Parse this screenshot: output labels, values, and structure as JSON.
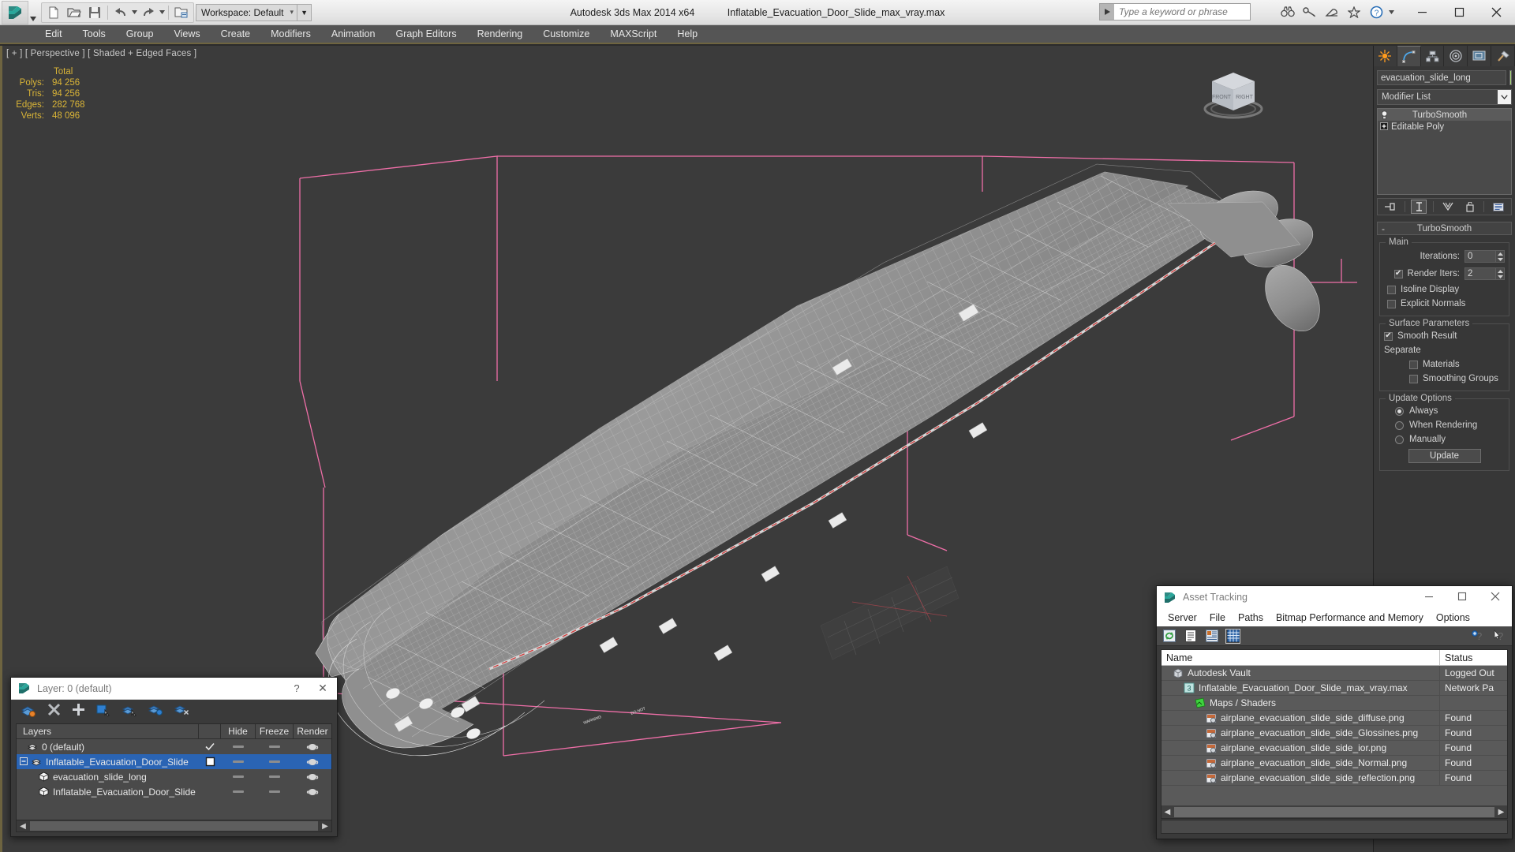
{
  "titlebar": {
    "workspace_label": "Workspace: Default",
    "app_title": "Autodesk 3ds Max  2014 x64",
    "file_title": "Inflatable_Evacuation_Door_Slide_max_vray.max",
    "search_placeholder": "Type a keyword or phrase",
    "quick_access": [
      {
        "name": "new-file-icon",
        "label": "New"
      },
      {
        "name": "open-file-icon",
        "label": "Open"
      },
      {
        "name": "save-file-icon",
        "label": "Save"
      },
      {
        "name": "undo-icon",
        "label": "Undo"
      },
      {
        "name": "redo-icon",
        "label": "Redo"
      },
      {
        "name": "set-project-folder-icon",
        "label": "Set Project Folder"
      }
    ],
    "help_icons": [
      {
        "name": "search-binoculars-icon",
        "label": "Search"
      },
      {
        "name": "key-icon",
        "label": "Subscription"
      },
      {
        "name": "satellite-dish-icon",
        "label": "Communication Center"
      },
      {
        "name": "favorites-star-icon",
        "label": "Favorites"
      },
      {
        "name": "help-question-icon",
        "label": "Help"
      }
    ],
    "window_controls": [
      {
        "name": "minimize-button",
        "glyph": "—"
      },
      {
        "name": "restore-button",
        "glyph": "☐"
      },
      {
        "name": "close-button",
        "glyph": "✕"
      }
    ]
  },
  "menubar": {
    "items": [
      {
        "label": "Edit"
      },
      {
        "label": "Tools"
      },
      {
        "label": "Group"
      },
      {
        "label": "Views"
      },
      {
        "label": "Create"
      },
      {
        "label": "Modifiers"
      },
      {
        "label": "Animation"
      },
      {
        "label": "Graph Editors"
      },
      {
        "label": "Rendering"
      },
      {
        "label": "Customize"
      },
      {
        "label": "MAXScript"
      },
      {
        "label": "Help"
      }
    ]
  },
  "viewport": {
    "label": "[ + ] [ Perspective ] [ Shaded + Edged Faces ]",
    "stats": {
      "column_header": "Total",
      "rows": [
        {
          "label": "Polys:",
          "value": "94 256"
        },
        {
          "label": "Tris:",
          "value": "94 256"
        },
        {
          "label": "Edges:",
          "value": "282 768"
        },
        {
          "label": "Verts:",
          "value": "48 096"
        }
      ]
    },
    "viewcube": {
      "front_face": "FRONT",
      "side_face": "RIGHT"
    }
  },
  "command_panel": {
    "tabs": [
      {
        "name": "tab-create",
        "label": "Create",
        "active": false
      },
      {
        "name": "tab-modify",
        "label": "Modify",
        "active": true
      },
      {
        "name": "tab-hierarchy",
        "label": "Hierarchy",
        "active": false
      },
      {
        "name": "tab-motion",
        "label": "Motion",
        "active": false
      },
      {
        "name": "tab-display",
        "label": "Display",
        "active": false
      },
      {
        "name": "tab-utilities",
        "label": "Utilities",
        "active": false
      }
    ],
    "object_name": "evacuation_slide_long",
    "object_color": "#a8d87a",
    "modifier_list_label": "Modifier List",
    "modifier_stack": [
      {
        "label": "TurboSmooth",
        "selected": true
      },
      {
        "label": "Editable Poly",
        "selected": false
      }
    ],
    "stack_buttons": [
      {
        "name": "pin-stack-button"
      },
      {
        "name": "show-end-result-button"
      },
      {
        "name": "make-unique-button"
      },
      {
        "name": "remove-modifier-button"
      },
      {
        "name": "configure-modifier-sets-button"
      }
    ],
    "rollout": {
      "title": "TurboSmooth",
      "collapse_glyph": "-",
      "main_group_title": "Main",
      "iterations_label": "Iterations:",
      "iterations_value": "0",
      "render_iters_label": "Render Iters:",
      "render_iters_value": "2",
      "render_iters_checked": true,
      "isoline_display_label": "Isoline Display",
      "isoline_display_checked": false,
      "explicit_normals_label": "Explicit Normals",
      "explicit_normals_checked": false,
      "surface_group_title": "Surface Parameters",
      "smooth_result_label": "Smooth Result",
      "smooth_result_checked": true,
      "separate_label": "Separate",
      "materials_label": "Materials",
      "materials_checked": false,
      "smoothing_groups_label": "Smoothing Groups",
      "smoothing_groups_checked": false,
      "update_group_title": "Update Options",
      "update_always_label": "Always",
      "update_when_rendering_label": "When Rendering",
      "update_manually_label": "Manually",
      "update_selected": "Always",
      "update_button_label": "Update"
    }
  },
  "layer_dialog": {
    "title": "Layer: 0 (default)",
    "help_glyph": "?",
    "close_glyph": "✕",
    "toolbar": [
      {
        "name": "create-new-layer-icon"
      },
      {
        "name": "delete-layer-icon"
      },
      {
        "name": "add-selection-to-layer-icon"
      },
      {
        "name": "select-objects-in-layer-icon"
      },
      {
        "name": "select-highlighted-objects-icon"
      },
      {
        "name": "highlight-selected-objects-icon"
      },
      {
        "name": "hide-unhide-layer-icon"
      }
    ],
    "columns": [
      "Layers",
      "",
      "Hide",
      "Freeze",
      "Render"
    ],
    "rows": [
      {
        "name": "0 (default)",
        "indent": 1,
        "icon": "layer-icon",
        "selected": false,
        "hide_mark": "check",
        "expander": ""
      },
      {
        "name": "Inflatable_Evacuation_Door_Slide",
        "indent": 1,
        "icon": "layer-icon",
        "selected": true,
        "hide_mark": "box",
        "expander": "-"
      },
      {
        "name": "evacuation_slide_long",
        "indent": 2,
        "icon": "object-icon",
        "selected": false,
        "hide_mark": "",
        "expander": ""
      },
      {
        "name": "Inflatable_Evacuation_Door_Slide",
        "indent": 2,
        "icon": "object-icon",
        "selected": false,
        "hide_mark": "",
        "expander": ""
      }
    ]
  },
  "asset_tracking": {
    "title": "Asset Tracking",
    "window_controls": [
      {
        "name": "minimize-button",
        "glyph": "—"
      },
      {
        "name": "restore-button",
        "glyph": "☐"
      },
      {
        "name": "close-button",
        "glyph": "✕"
      }
    ],
    "menu": [
      "Server",
      "File",
      "Paths",
      "Bitmap Performance and Memory",
      "Options"
    ],
    "toolbar": [
      {
        "name": "refresh-icon",
        "selected": false
      },
      {
        "name": "list-view-icon",
        "selected": false
      },
      {
        "name": "detail-view-icon",
        "selected": false
      },
      {
        "name": "grid-view-icon",
        "selected": true
      }
    ],
    "toolbar_right": [
      {
        "name": "help-add-icon"
      },
      {
        "name": "help-pointer-icon"
      }
    ],
    "columns": [
      "Name",
      "Status"
    ],
    "rows": [
      {
        "name": "Autodesk Vault",
        "status": "Logged Out",
        "indent": 1,
        "icon": "vault-icon"
      },
      {
        "name": "Inflatable_Evacuation_Door_Slide_max_vray.max",
        "status": "Network Pa",
        "indent": 2,
        "icon": "max-file-icon"
      },
      {
        "name": "Maps / Shaders",
        "status": "",
        "indent": 3,
        "icon": "maps-shaders-icon"
      },
      {
        "name": "airplane_evacuation_slide_side_diffuse.png",
        "status": "Found",
        "indent": 4,
        "icon": "bitmap-icon"
      },
      {
        "name": "airplane_evacuation_slide_side_Glossines.png",
        "status": "Found",
        "indent": 4,
        "icon": "bitmap-icon"
      },
      {
        "name": "airplane_evacuation_slide_side_ior.png",
        "status": "Found",
        "indent": 4,
        "icon": "bitmap-icon"
      },
      {
        "name": "airplane_evacuation_slide_side_Normal.png",
        "status": "Found",
        "indent": 4,
        "icon": "bitmap-icon"
      },
      {
        "name": "airplane_evacuation_slide_side_reflection.png",
        "status": "Found",
        "indent": 4,
        "icon": "bitmap-icon"
      }
    ],
    "scroll_left_glyph": "◀",
    "scroll_right_glyph": "▶"
  },
  "colors": {
    "viewport_bg": "#3b3b3b",
    "accent_yellow": "#d9b437",
    "selection_blue": "#2a64b4",
    "gizmo_pink": "#ef6fa8",
    "object_color": "#a8d87a"
  }
}
